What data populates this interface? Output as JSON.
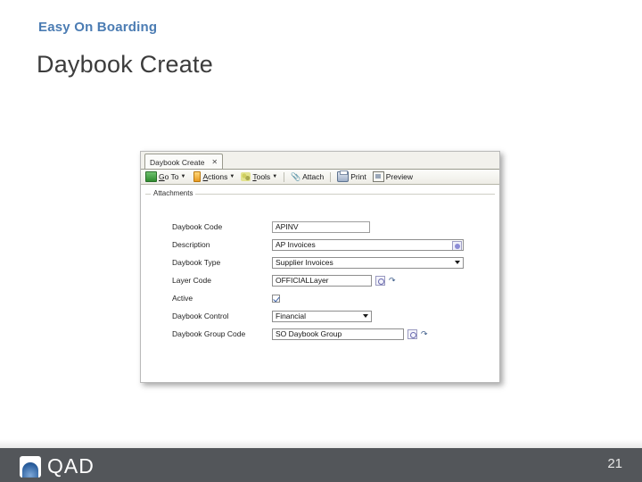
{
  "slide": {
    "eyebrow": "Easy On Boarding",
    "title": "Daybook Create",
    "page_number": "21",
    "accent_color": "#4b7cb3",
    "footer_color": "#53565a"
  },
  "app": {
    "tab": {
      "label": "Daybook Create",
      "close_glyph": "✕"
    },
    "toolbar": {
      "items": [
        {
          "label_pre": "",
          "label_u": "G",
          "label_post": "o To",
          "icon": "goto-icon",
          "has_caret": true
        },
        {
          "label_pre": "",
          "label_u": "A",
          "label_post": "ctions",
          "icon": "actions-icon",
          "has_caret": true
        },
        {
          "label_pre": "",
          "label_u": "T",
          "label_post": "ools",
          "icon": "tools-icon",
          "has_caret": true
        },
        {
          "label_pre": "",
          "label_u": "",
          "label_post": "Attach",
          "icon": "paperclip-icon",
          "has_caret": false
        },
        {
          "label_pre": "",
          "label_u": "",
          "label_post": "Print",
          "icon": "printer-icon",
          "has_caret": false
        },
        {
          "label_pre": "",
          "label_u": "",
          "label_post": "Preview",
          "icon": "preview-icon",
          "has_caret": false
        }
      ],
      "go_to": "Go To",
      "actions": "Actions",
      "tools": "Tools",
      "attach": "Attach",
      "print": "Print",
      "preview": "Preview"
    },
    "group_label": "Attachments",
    "form": {
      "daybook_code_label": "Daybook Code",
      "daybook_code_value": "APINV",
      "description_label": "Description",
      "description_value": "AP Invoices",
      "daybook_type_label": "Daybook Type",
      "daybook_type_value": "Supplier Invoices",
      "layer_code_label": "Layer Code",
      "layer_code_value": "OFFICIALLayer",
      "active_label": "Active",
      "active_checked": "true",
      "daybook_control_label": "Daybook Control",
      "daybook_control_value": "Financial",
      "daybook_group_code_label": "Daybook Group Code",
      "daybook_group_code_value": "SO Daybook Group"
    }
  },
  "logo": {
    "text": "QAD"
  }
}
